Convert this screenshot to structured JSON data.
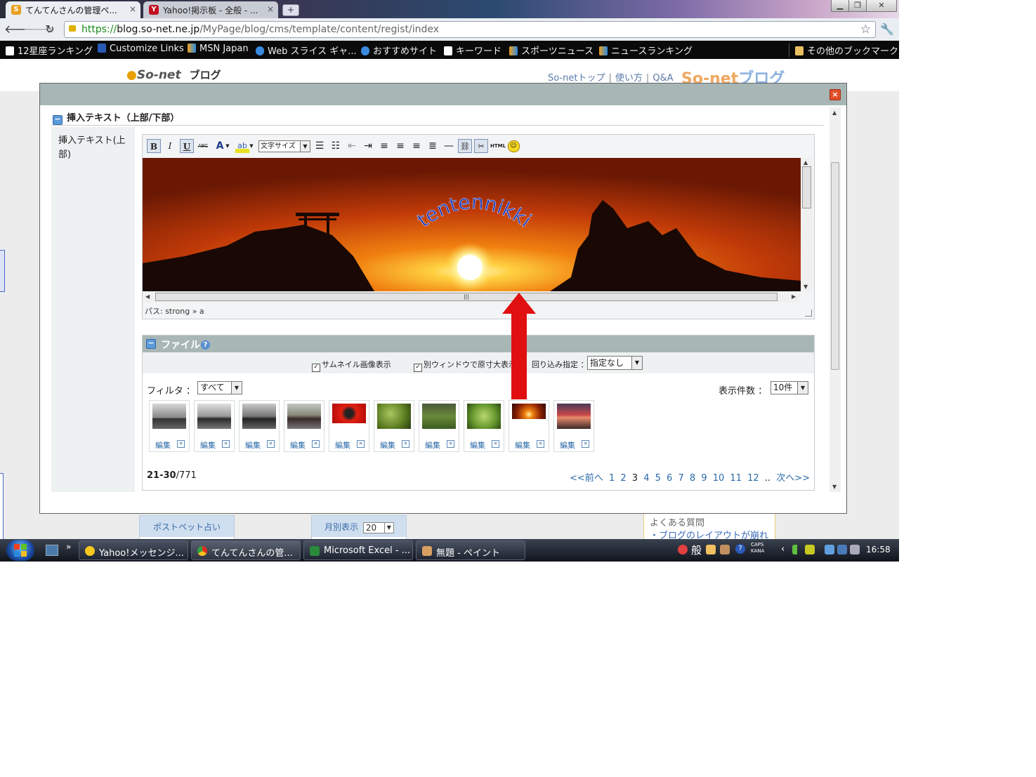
{
  "browser": {
    "tabs": [
      {
        "title": "てんてんさんの管理ペ...",
        "favicon": "so-net-s-icon",
        "active": true
      },
      {
        "title": "Yahoo!掲示板 - 全般 - ...",
        "favicon": "yahoo-y-icon",
        "active": false
      }
    ],
    "url": {
      "protocol": "https://",
      "host": "blog.so-net.ne.jp",
      "path": "/MyPage/blog/cms/template/content/regist/index"
    },
    "bookmarks": [
      {
        "label": "12星座ランキング",
        "icon": "page-icon"
      },
      {
        "label": "Customize Links",
        "icon": "m-icon"
      },
      {
        "label": "MSN Japan",
        "icon": "msn-butterfly-icon"
      },
      {
        "label": "Web スライス ギャ...",
        "icon": "ie-icon"
      },
      {
        "label": "おすすめサイト",
        "icon": "ie-icon"
      },
      {
        "label": "キーワード",
        "icon": "page-icon"
      },
      {
        "label": "スポーツニュース",
        "icon": "msn-butterfly-icon"
      },
      {
        "label": "ニュースランキング",
        "icon": "msn-butterfly-icon"
      }
    ],
    "other_bookmarks": "その他のブックマーク"
  },
  "page": {
    "logo": "So-net",
    "logo_suffix": "ブログ",
    "nav": [
      "So-netトップ",
      "使い方",
      "Q&A"
    ],
    "brand_logo_a": "So-net",
    "brand_logo_b": "ブログ",
    "bottom_boxes": [
      "ポストペット占い",
      "月別表示"
    ],
    "monthly_select": "20",
    "faq": {
      "title": "よくある質問",
      "link": "・ブログのレイアウトが崩れる"
    }
  },
  "modal": {
    "close": "×",
    "section_title": "挿入テキスト（上部/下部）",
    "field_label": "挿入テキスト(上部)",
    "editor": {
      "toolbar": [
        {
          "name": "bold-button",
          "glyph": "B",
          "active": true
        },
        {
          "name": "italic-button",
          "glyph": "I",
          "active": false
        },
        {
          "name": "underline-button",
          "glyph": "U",
          "active": true
        },
        {
          "name": "strikethrough-button",
          "glyph": "ABC",
          "active": false
        }
      ],
      "font_size_label": "文字サイズ",
      "html_label": "HTML",
      "banner_text": "tentennikki",
      "path_text": "パス: strong » a"
    },
    "files": {
      "title": "ファイル",
      "help": "?",
      "thumbnail_option": "サムネイル画像表示",
      "new_window_option": "別ウィンドウで原寸大表示",
      "wrap_label": "回り込み指定 ：",
      "wrap_value": "指定なし",
      "filter_label": "フィルタ ：",
      "filter_value": "すべて",
      "count_label": "表示件数 ：",
      "count_value": "10件",
      "thumbnails": [
        {
          "edit": "編集",
          "kind": "motorcycle-photo"
        },
        {
          "edit": "編集",
          "kind": "motorcycle-photo"
        },
        {
          "edit": "編集",
          "kind": "motorcycle-photo"
        },
        {
          "edit": "編集",
          "kind": "motorcycle-photo"
        },
        {
          "edit": "編集",
          "kind": "red-photo"
        },
        {
          "edit": "編集",
          "kind": "plant-photo"
        },
        {
          "edit": "編集",
          "kind": "plant-photo"
        },
        {
          "edit": "編集",
          "kind": "plant-photo"
        },
        {
          "edit": "編集",
          "kind": "sunset-photo"
        },
        {
          "edit": "編集",
          "kind": "sunset-photo"
        }
      ],
      "range": "21-30",
      "total": "/771",
      "pager": {
        "prev": "<<前へ",
        "pages": [
          "1",
          "2",
          "3",
          "4",
          "5",
          "6",
          "7",
          "8",
          "9",
          "10",
          "11",
          "12",
          ".."
        ],
        "current": "3",
        "next": "次へ>>"
      }
    }
  },
  "taskbar": {
    "tasks": [
      {
        "label": "Yahoo!メッセンジ...",
        "icon": "yahoo-messenger-icon"
      },
      {
        "label": "てんてんさんの管...",
        "icon": "chrome-icon"
      },
      {
        "label": "Microsoft Excel - ...",
        "icon": "excel-icon"
      },
      {
        "label": "無題 - ペイント",
        "icon": "paint-icon"
      }
    ],
    "ime": "般",
    "caps": "CAPS",
    "kana": "KANA",
    "clock": "16:58"
  },
  "colors": {
    "modal_header": "#a8b6b6",
    "link": "#2a6aa8",
    "arrow": "#e01010"
  }
}
